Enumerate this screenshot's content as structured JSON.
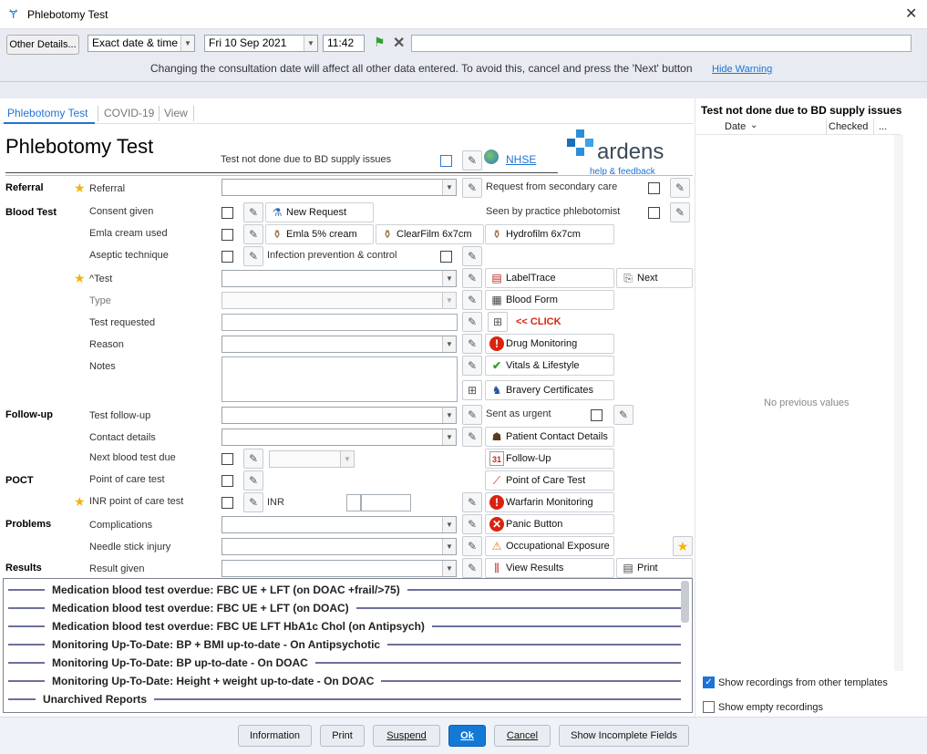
{
  "window": {
    "title": "Phlebotomy Test",
    "close_icon": "close-icon"
  },
  "toolbar": {
    "other_details": "Other Details...",
    "date_mode": "Exact date & time",
    "date": "Fri 10 Sep 2021",
    "time": "11:42",
    "warning": "Changing the consultation date will affect all other data entered. To avoid this, cancel and press the 'Next' button",
    "hide_warning": "Hide Warning"
  },
  "tabs": [
    "Phlebotomy Test",
    "COVID-19",
    "View"
  ],
  "form": {
    "title": "Phlebotomy Test",
    "test_not_done": "Test not done due to BD supply issues",
    "nhse": "NHSE",
    "logo_text": "ardens",
    "logo_sub": "help & feedback",
    "sections": {
      "referral": "Referral",
      "blood_test": "Blood Test",
      "follow_up": "Follow-up",
      "poct": "POCT",
      "problems": "Problems",
      "results": "Results"
    },
    "labels": {
      "referral": "Referral",
      "request_secondary": "Request from secondary care",
      "consent": "Consent given",
      "seen_by": "Seen by practice phlebotomist",
      "emla": "Emla cream used",
      "aseptic": "Aseptic technique",
      "infection": "Infection prevention & control",
      "test": "^Test",
      "type": "Type",
      "test_requested": "Test requested",
      "reason": "Reason",
      "notes": "Notes",
      "test_follow_up": "Test follow-up",
      "sent_urgent": "Sent as urgent",
      "contact": "Contact details",
      "next_due": "Next blood test due",
      "poc_test": "Point of care test",
      "inr_poc": "INR point of care test",
      "inr": "INR",
      "complications": "Complications",
      "needle": "Needle stick injury",
      "result_given": "Result given"
    },
    "buttons": {
      "new_request": "New Request",
      "emla5": "Emla 5% cream",
      "clearfilm": "ClearFilm 6x7cm",
      "hydrofilm": "Hydrofilm 6x7cm",
      "labeltrace": "LabelTrace",
      "next": "Next",
      "blood_form": "Blood Form",
      "click": "<< CLICK",
      "drug_monitoring": "Drug Monitoring",
      "vitals": "Vitals & Lifestyle",
      "bravery": "Bravery Certificates",
      "patient_contact": "Patient Contact Details",
      "follow_up": "Follow-Up",
      "poc_test": "Point of Care Test",
      "warfarin": "Warfarin Monitoring",
      "panic": "Panic Button",
      "occupational": "Occupational Exposure",
      "view_results": "View Results",
      "print": "Print"
    }
  },
  "alerts": [
    "Medication blood test overdue: FBC UE + LFT (on DOAC +frail/>75)",
    "Medication blood test overdue: FBC UE + LFT (on DOAC)",
    "Medication blood test overdue: FBC UE LFT HbA1c Chol (on Antipsych)",
    "Monitoring Up-To-Date: BP + BMI up-to-date - On Antipsychotic",
    "Monitoring Up-To-Date: BP up-to-date - On DOAC",
    "Monitoring Up-To-Date: Height + weight up-to-date - On DOAC",
    "Unarchived Reports"
  ],
  "right_panel": {
    "title": "Test not done due to BD supply issues",
    "col_date": "Date",
    "col_checked": "Checked",
    "col_more": "...",
    "empty": "No previous values",
    "show_other": "Show recordings from other templates",
    "show_empty": "Show empty recordings"
  },
  "footer": {
    "information": "Information",
    "print": "Print",
    "suspend": "Suspend",
    "ok": "Ok",
    "cancel": "Cancel",
    "show_incomplete": "Show Incomplete Fields"
  },
  "colors": {
    "accent": "#1e73d6",
    "ok_button": "#1479d6",
    "alert_line": "#6d6f9b",
    "click_red": "#d9230f"
  }
}
